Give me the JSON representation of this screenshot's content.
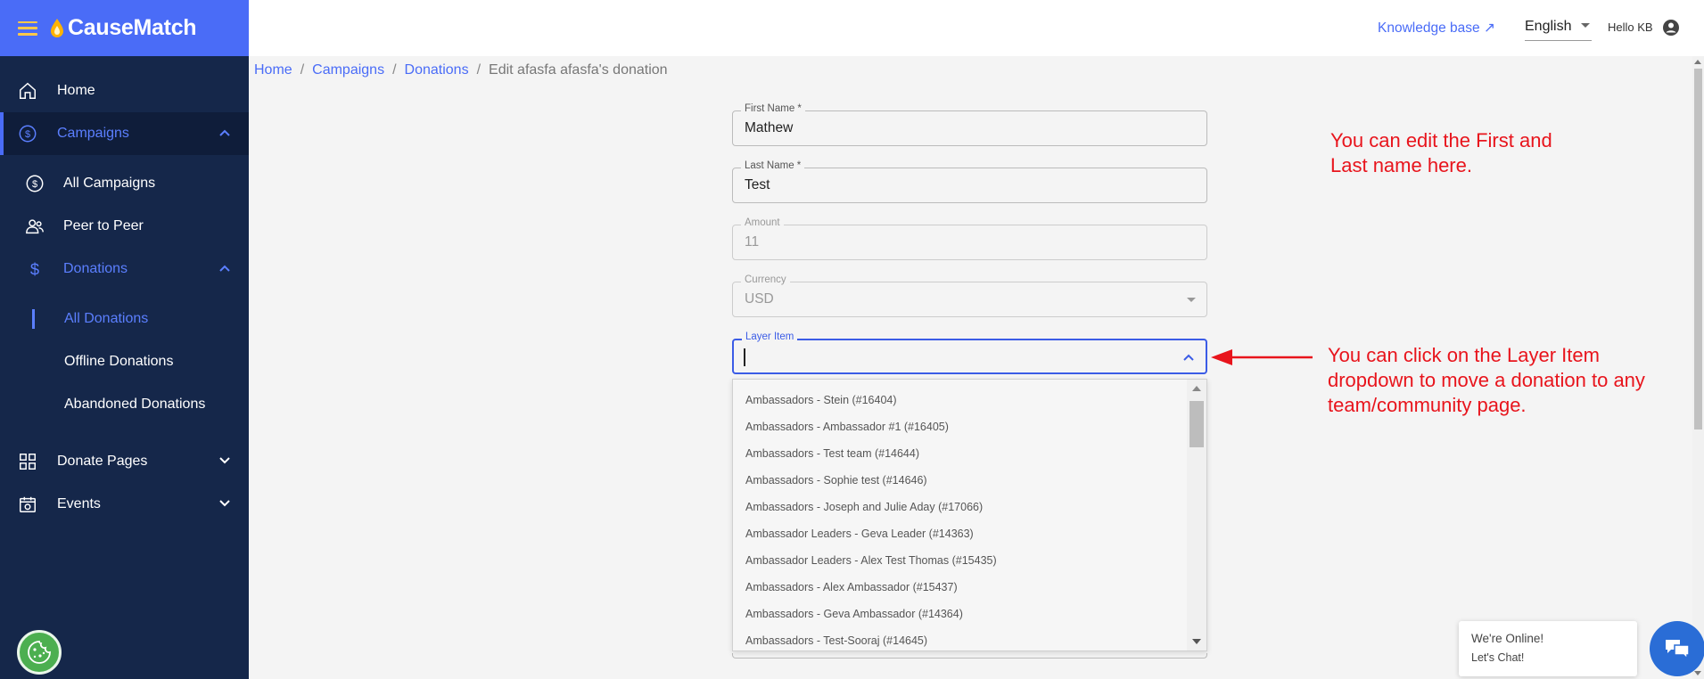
{
  "brand": {
    "name": "CauseMatch"
  },
  "sidebar": {
    "items": [
      {
        "label": "Home"
      },
      {
        "label": "Campaigns"
      },
      {
        "label": "All Campaigns"
      },
      {
        "label": "Peer to Peer"
      },
      {
        "label": "Donations"
      },
      {
        "label": "All Donations"
      },
      {
        "label": "Offline Donations"
      },
      {
        "label": "Abandoned Donations"
      },
      {
        "label": "Donate Pages"
      },
      {
        "label": "Events"
      }
    ]
  },
  "topbar": {
    "knowledge_base": "Knowledge base",
    "language": "English",
    "greeting": "Hello KB"
  },
  "breadcrumb": {
    "home": "Home",
    "campaigns": "Campaigns",
    "donations": "Donations",
    "current": "Edit afasfa afasfa's donation"
  },
  "form": {
    "first_name": {
      "label": "First Name *",
      "value": "Mathew"
    },
    "last_name": {
      "label": "Last Name *",
      "value": "Test"
    },
    "amount": {
      "label": "Amount",
      "value": "11"
    },
    "currency": {
      "label": "Currency",
      "value": "USD"
    },
    "layer_item": {
      "label": "Layer Item",
      "value": ""
    }
  },
  "layer_options": [
    "Ambassadors - Stein (#16404)",
    "Ambassadors - Ambassador #1 (#16405)",
    "Ambassadors - Test team (#14644)",
    "Ambassadors - Sophie test (#14646)",
    "Ambassadors - Joseph and Julie Aday (#17066)",
    "Ambassador Leaders - Geva Leader (#14363)",
    "Ambassador Leaders - Alex Test Thomas (#15435)",
    "Ambassadors - Alex Ambassador (#15437)",
    "Ambassadors - Geva Ambassador (#14364)",
    "Ambassadors - Test-Sooraj (#14645)"
  ],
  "annotations": {
    "note1_line1": "You can edit the First and",
    "note1_line2": "Last name here.",
    "note2_line1": "You can click on the Layer Item",
    "note2_line2": "dropdown to move a donation to any",
    "note2_line3": "team/community page."
  },
  "chat": {
    "line1": "We're Online!",
    "line2": "Let's Chat!"
  },
  "colors": {
    "sidebar": "#15274a",
    "brand": "#4a6cf7",
    "accent": "#5b7fff",
    "annotation": "#e8141c",
    "focus": "#3b5ce6",
    "chat": "#2a6dd6",
    "cookie": "#4caf50"
  }
}
